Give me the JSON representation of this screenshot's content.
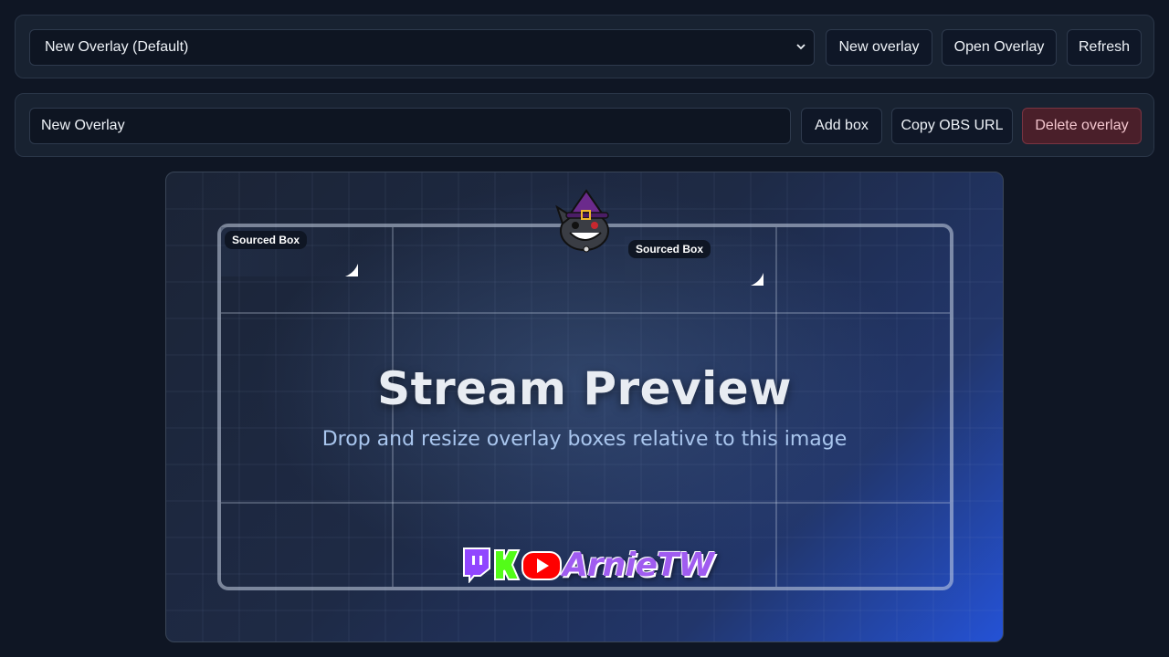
{
  "top_bar": {
    "overlay_select": {
      "selected": "New Overlay (Default)"
    },
    "new_overlay_label": "New overlay",
    "open_overlay_label": "Open Overlay",
    "refresh_label": "Refresh"
  },
  "editor_bar": {
    "overlay_name": {
      "value": "New Overlay"
    },
    "add_box_label": "Add box",
    "copy_obs_url_label": "Copy OBS URL",
    "delete_overlay_label": "Delete overlay"
  },
  "preview": {
    "title": "Stream Preview",
    "subtitle": "Drop and resize overlay boxes relative to this image",
    "boxes": [
      {
        "label": "Sourced Box"
      },
      {
        "label": "Sourced Box"
      }
    ],
    "logo_text": "ArnieTW"
  },
  "colors": {
    "background": "#0f1624",
    "panel": "#182231",
    "danger": "#4a1f2a",
    "twitch": "#9146ff",
    "kick": "#53fc18",
    "youtube": "#ff0000"
  }
}
